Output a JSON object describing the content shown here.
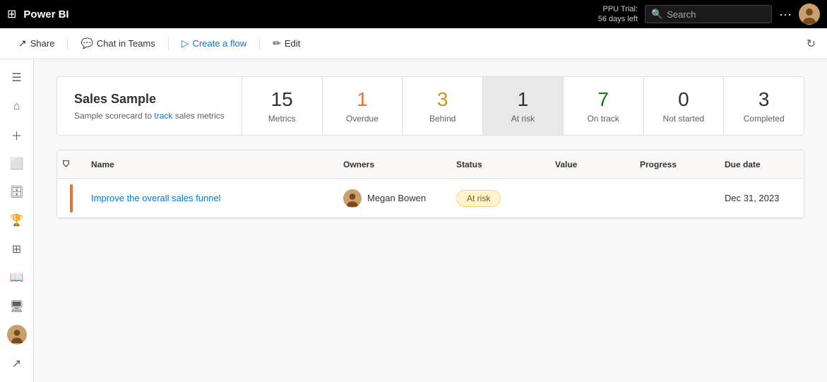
{
  "topbar": {
    "logo": "Power BI",
    "trial_line1": "PPU Trial:",
    "trial_line2": "56 days left",
    "search_placeholder": "Search",
    "more_icon": "more-options"
  },
  "subtoolbar": {
    "share_label": "Share",
    "chat_label": "Chat in Teams",
    "create_label": "Create a flow",
    "edit_label": "Edit"
  },
  "leftnav": {
    "items": [
      {
        "name": "home",
        "icon": "⌂"
      },
      {
        "name": "create",
        "icon": "+"
      },
      {
        "name": "browse",
        "icon": "❑"
      },
      {
        "name": "data-hub",
        "icon": "🗄"
      },
      {
        "name": "monitoring",
        "icon": "🏆"
      },
      {
        "name": "apps",
        "icon": "⊞"
      },
      {
        "name": "learn",
        "icon": "📖"
      },
      {
        "name": "workspaces",
        "icon": "🖥"
      }
    ]
  },
  "scorecard": {
    "title": "Sales Sample",
    "description_plain": "Sample scorecard to track sales metrics",
    "description_link": "track",
    "metrics": [
      {
        "id": "metrics",
        "number": "15",
        "label": "Metrics",
        "selected": false,
        "type": "metrics"
      },
      {
        "id": "overdue",
        "number": "1",
        "label": "Overdue",
        "selected": false,
        "type": "overdue"
      },
      {
        "id": "behind",
        "number": "3",
        "label": "Behind",
        "selected": false,
        "type": "behind"
      },
      {
        "id": "atrisk",
        "number": "1",
        "label": "At risk",
        "selected": true,
        "type": "atrisk"
      },
      {
        "id": "ontrack",
        "number": "7",
        "label": "On track",
        "selected": false,
        "type": "ontrack"
      },
      {
        "id": "notstarted",
        "number": "0",
        "label": "Not started",
        "selected": false,
        "type": "notstarted"
      },
      {
        "id": "completed",
        "number": "3",
        "label": "Completed",
        "selected": false,
        "type": "completed"
      }
    ]
  },
  "table": {
    "columns": [
      "",
      "Name",
      "Owners",
      "Status",
      "Value",
      "Progress",
      "Due date"
    ],
    "rows": [
      {
        "name": "Improve the overall sales funnel",
        "owner": "Megan Bowen",
        "status": "At risk",
        "value": "",
        "progress": "",
        "due_date": "Dec 31, 2023"
      }
    ]
  }
}
